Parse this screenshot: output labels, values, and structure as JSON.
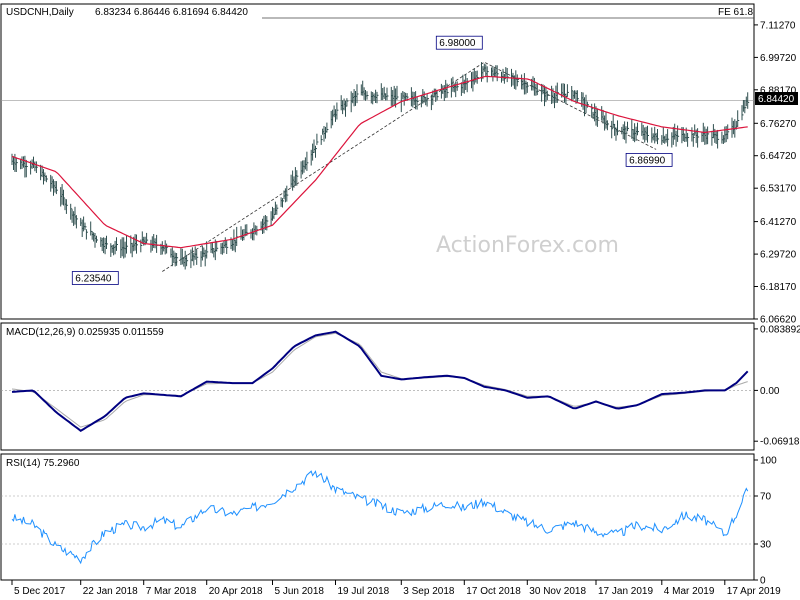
{
  "chart_data": [
    {
      "type": "ohlc",
      "symbol_label": "USDCNH,Daily",
      "ohlc_label": "6.83234 6.86446 6.81694 6.84420",
      "fib_label": "FE 61.8",
      "watermark": "ActionForex.com",
      "last_price_label": "6.84420",
      "ylim": [
        6.0662,
        7.1872
      ],
      "y_ticks": [
        "7.11270",
        "6.99720",
        "6.88170",
        "6.76270",
        "6.64720",
        "6.53170",
        "6.41270",
        "6.29720",
        "6.18170",
        "6.06620"
      ],
      "y_tick_values": [
        7.1127,
        6.9972,
        6.8817,
        6.7627,
        6.6472,
        6.5317,
        6.4127,
        6.2972,
        6.1817,
        6.0662
      ],
      "annotations": [
        {
          "label": "6.98000",
          "x": "2018-10-31",
          "y": 6.98
        },
        {
          "label": "6.86990",
          "x": "2019-02-28",
          "y": 6.6699
        },
        {
          "label": "6.23540",
          "x": "2018-03-20",
          "y": 6.2354
        }
      ],
      "close_series": {
        "x": [
          "2017-12-05",
          "2017-12-20",
          "2018-01-05",
          "2018-01-22",
          "2018-02-08",
          "2018-02-22",
          "2018-03-07",
          "2018-03-20",
          "2018-04-02",
          "2018-04-20",
          "2018-05-08",
          "2018-05-22",
          "2018-06-05",
          "2018-06-20",
          "2018-07-05",
          "2018-07-19",
          "2018-08-05",
          "2018-08-20",
          "2018-09-03",
          "2018-09-20",
          "2018-10-05",
          "2018-10-17",
          "2018-10-31",
          "2018-11-15",
          "2018-11-30",
          "2018-12-15",
          "2019-01-02",
          "2019-01-17",
          "2019-02-01",
          "2019-02-15",
          "2019-03-04",
          "2019-03-20",
          "2019-04-03",
          "2019-04-17",
          "2019-04-25",
          "2019-05-03"
        ],
        "values": [
          6.628,
          6.611,
          6.53,
          6.4,
          6.33,
          6.318,
          6.34,
          6.326,
          6.272,
          6.3,
          6.34,
          6.38,
          6.43,
          6.56,
          6.68,
          6.8,
          6.87,
          6.86,
          6.85,
          6.85,
          6.88,
          6.9,
          6.95,
          6.93,
          6.9,
          6.86,
          6.87,
          6.79,
          6.74,
          6.73,
          6.71,
          6.72,
          6.72,
          6.712,
          6.76,
          6.844
        ]
      },
      "ma_series": {
        "name": "",
        "x": [
          "2017-12-05",
          "2018-01-05",
          "2018-02-08",
          "2018-03-07",
          "2018-04-02",
          "2018-05-08",
          "2018-06-05",
          "2018-07-05",
          "2018-08-05",
          "2018-09-03",
          "2018-10-05",
          "2018-11-01",
          "2018-12-01",
          "2019-01-02",
          "2019-02-01",
          "2019-03-04",
          "2019-04-03",
          "2019-05-03"
        ],
        "values": [
          6.645,
          6.59,
          6.4,
          6.335,
          6.32,
          6.35,
          6.4,
          6.56,
          6.76,
          6.84,
          6.89,
          6.93,
          6.92,
          6.84,
          6.79,
          6.75,
          6.73,
          6.75
        ]
      },
      "trendline": {
        "x": [
          "2018-03-20",
          "2018-10-31",
          "2019-02-28"
        ],
        "values": [
          6.2354,
          6.98,
          6.6699
        ]
      }
    },
    {
      "type": "line",
      "label": "MACD(12,26,9) 0.025935 0.011559",
      "ylim": [
        -0.0812,
        0.0919
      ],
      "y_ticks": [
        "0.083892",
        "0.00",
        "-0.069189"
      ],
      "y_tick_values": [
        0.083892,
        0,
        -0.069189
      ],
      "x": [
        "2017-12-05",
        "2017-12-20",
        "2018-01-05",
        "2018-01-22",
        "2018-02-08",
        "2018-02-22",
        "2018-03-07",
        "2018-03-20",
        "2018-04-02",
        "2018-04-20",
        "2018-05-08",
        "2018-05-22",
        "2018-06-05",
        "2018-06-20",
        "2018-07-05",
        "2018-07-19",
        "2018-08-05",
        "2018-08-20",
        "2018-09-03",
        "2018-09-20",
        "2018-10-05",
        "2018-10-17",
        "2018-10-31",
        "2018-11-15",
        "2018-11-30",
        "2018-12-15",
        "2019-01-02",
        "2019-01-17",
        "2019-02-01",
        "2019-02-15",
        "2019-03-04",
        "2019-03-20",
        "2019-04-03",
        "2019-04-17",
        "2019-04-25",
        "2019-05-03"
      ],
      "series": [
        {
          "name": "",
          "color": "#000080",
          "values": [
            -0.002,
            0.0,
            -0.03,
            -0.055,
            -0.035,
            -0.01,
            -0.004,
            -0.006,
            -0.008,
            0.012,
            0.01,
            0.01,
            0.03,
            0.06,
            0.075,
            0.08,
            0.06,
            0.02,
            0.015,
            0.018,
            0.02,
            0.017,
            0.005,
            0.0,
            -0.01,
            -0.008,
            -0.025,
            -0.015,
            -0.025,
            -0.02,
            -0.005,
            -0.003,
            0.0,
            0.0,
            0.01,
            0.026
          ]
        },
        {
          "name": "",
          "color": "#aaaaaa",
          "values": [
            0.002,
            -0.002,
            -0.025,
            -0.05,
            -0.04,
            -0.015,
            -0.006,
            -0.006,
            -0.007,
            0.009,
            0.01,
            0.01,
            0.025,
            0.055,
            0.073,
            0.078,
            0.063,
            0.025,
            0.016,
            0.017,
            0.019,
            0.017,
            0.007,
            0.001,
            -0.008,
            -0.008,
            -0.022,
            -0.016,
            -0.023,
            -0.02,
            -0.007,
            -0.004,
            -0.001,
            0.0,
            0.007,
            0.012
          ]
        }
      ]
    },
    {
      "type": "line",
      "label": "RSI(14) 75.2960",
      "ylim": [
        0,
        105
      ],
      "y_ticks": [
        "100",
        "70",
        "30",
        "0"
      ],
      "y_tick_values": [
        100,
        70,
        30,
        0
      ],
      "levels": [
        70,
        30
      ],
      "x": [
        "2017-12-05",
        "2017-12-20",
        "2018-01-05",
        "2018-01-22",
        "2018-02-08",
        "2018-02-22",
        "2018-03-07",
        "2018-03-20",
        "2018-04-02",
        "2018-04-20",
        "2018-05-08",
        "2018-05-22",
        "2018-06-05",
        "2018-06-20",
        "2018-07-05",
        "2018-07-19",
        "2018-08-05",
        "2018-08-20",
        "2018-09-03",
        "2018-09-20",
        "2018-10-05",
        "2018-10-17",
        "2018-10-31",
        "2018-11-15",
        "2018-11-30",
        "2018-12-15",
        "2019-01-02",
        "2019-01-17",
        "2019-02-01",
        "2019-02-15",
        "2019-03-04",
        "2019-03-20",
        "2019-04-03",
        "2019-04-17",
        "2019-04-25",
        "2019-05-03"
      ],
      "series": [
        {
          "name": "",
          "color": "#1e90ff",
          "values": [
            52,
            46,
            28,
            18,
            40,
            46,
            44,
            50,
            44,
            60,
            55,
            60,
            66,
            78,
            90,
            76,
            68,
            62,
            56,
            60,
            64,
            60,
            66,
            56,
            48,
            42,
            48,
            40,
            38,
            46,
            42,
            54,
            50,
            38,
            55,
            75.3
          ]
        }
      ]
    }
  ],
  "x_axis": {
    "labels": [
      "5 Dec 2017",
      "22 Jan 2018",
      "7 Mar 2018",
      "20 Apr 2018",
      "5 Jun 2018",
      "19 Jul 2018",
      "3 Sep 2018",
      "17 Oct 2018",
      "30 Nov 2018",
      "17 Jan 2019",
      "4 Mar 2019",
      "17 Apr 2019"
    ],
    "values": [
      "2017-12-05",
      "2018-01-22",
      "2018-03-07",
      "2018-04-20",
      "2018-06-05",
      "2018-07-19",
      "2018-09-03",
      "2018-10-17",
      "2018-11-30",
      "2019-01-17",
      "2019-03-04",
      "2019-04-17"
    ]
  },
  "colors": {
    "bars": "#2f4f4f",
    "ma": "#dc143c",
    "macd": "#000080",
    "signal": "#aaaaaa",
    "rsi": "#1e90ff",
    "grid": "#888888"
  }
}
